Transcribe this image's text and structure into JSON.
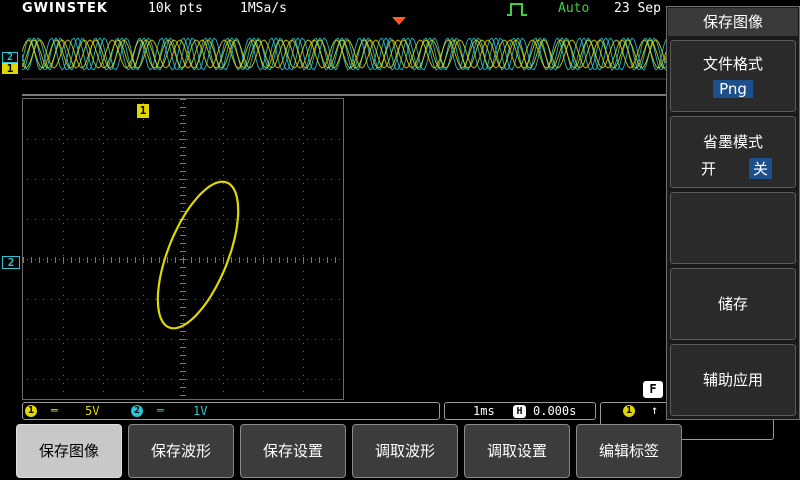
{
  "topbar": {
    "brand": "GWINSTEK",
    "record_length": "10k pts",
    "sample_rate": "1MSa/s",
    "trigger_mode": "Auto",
    "date": "23 Sep"
  },
  "markers": {
    "ch2_label": "2",
    "ch1_label": "1",
    "grid_ch1": "1",
    "grid_ch2": "2"
  },
  "status": {
    "ch1_num": "1",
    "ch1_scale": "5V",
    "ch2_num": "2",
    "ch2_scale": "1V",
    "timebase": "1ms",
    "h_label": "H",
    "h_position": "0.000s",
    "trig_source": "1",
    "trig_slope": "↑",
    "f_label": "F"
  },
  "side_menu": {
    "title": "保存图像",
    "file_format_label": "文件格式",
    "file_format_value": "Png",
    "ink_saver_label": "省墨模式",
    "ink_on": "开",
    "ink_off": "关",
    "save_label": "储存",
    "assist_label": "辅助应用"
  },
  "bottom_menu": {
    "items": [
      "保存图像",
      "保存波形",
      "保存设置",
      "调取波形",
      "调取设置",
      "编辑标签"
    ]
  },
  "colors": {
    "ch1": "#e0d600",
    "ch2": "#27c6d6",
    "trigger": "#ff5a1f"
  }
}
